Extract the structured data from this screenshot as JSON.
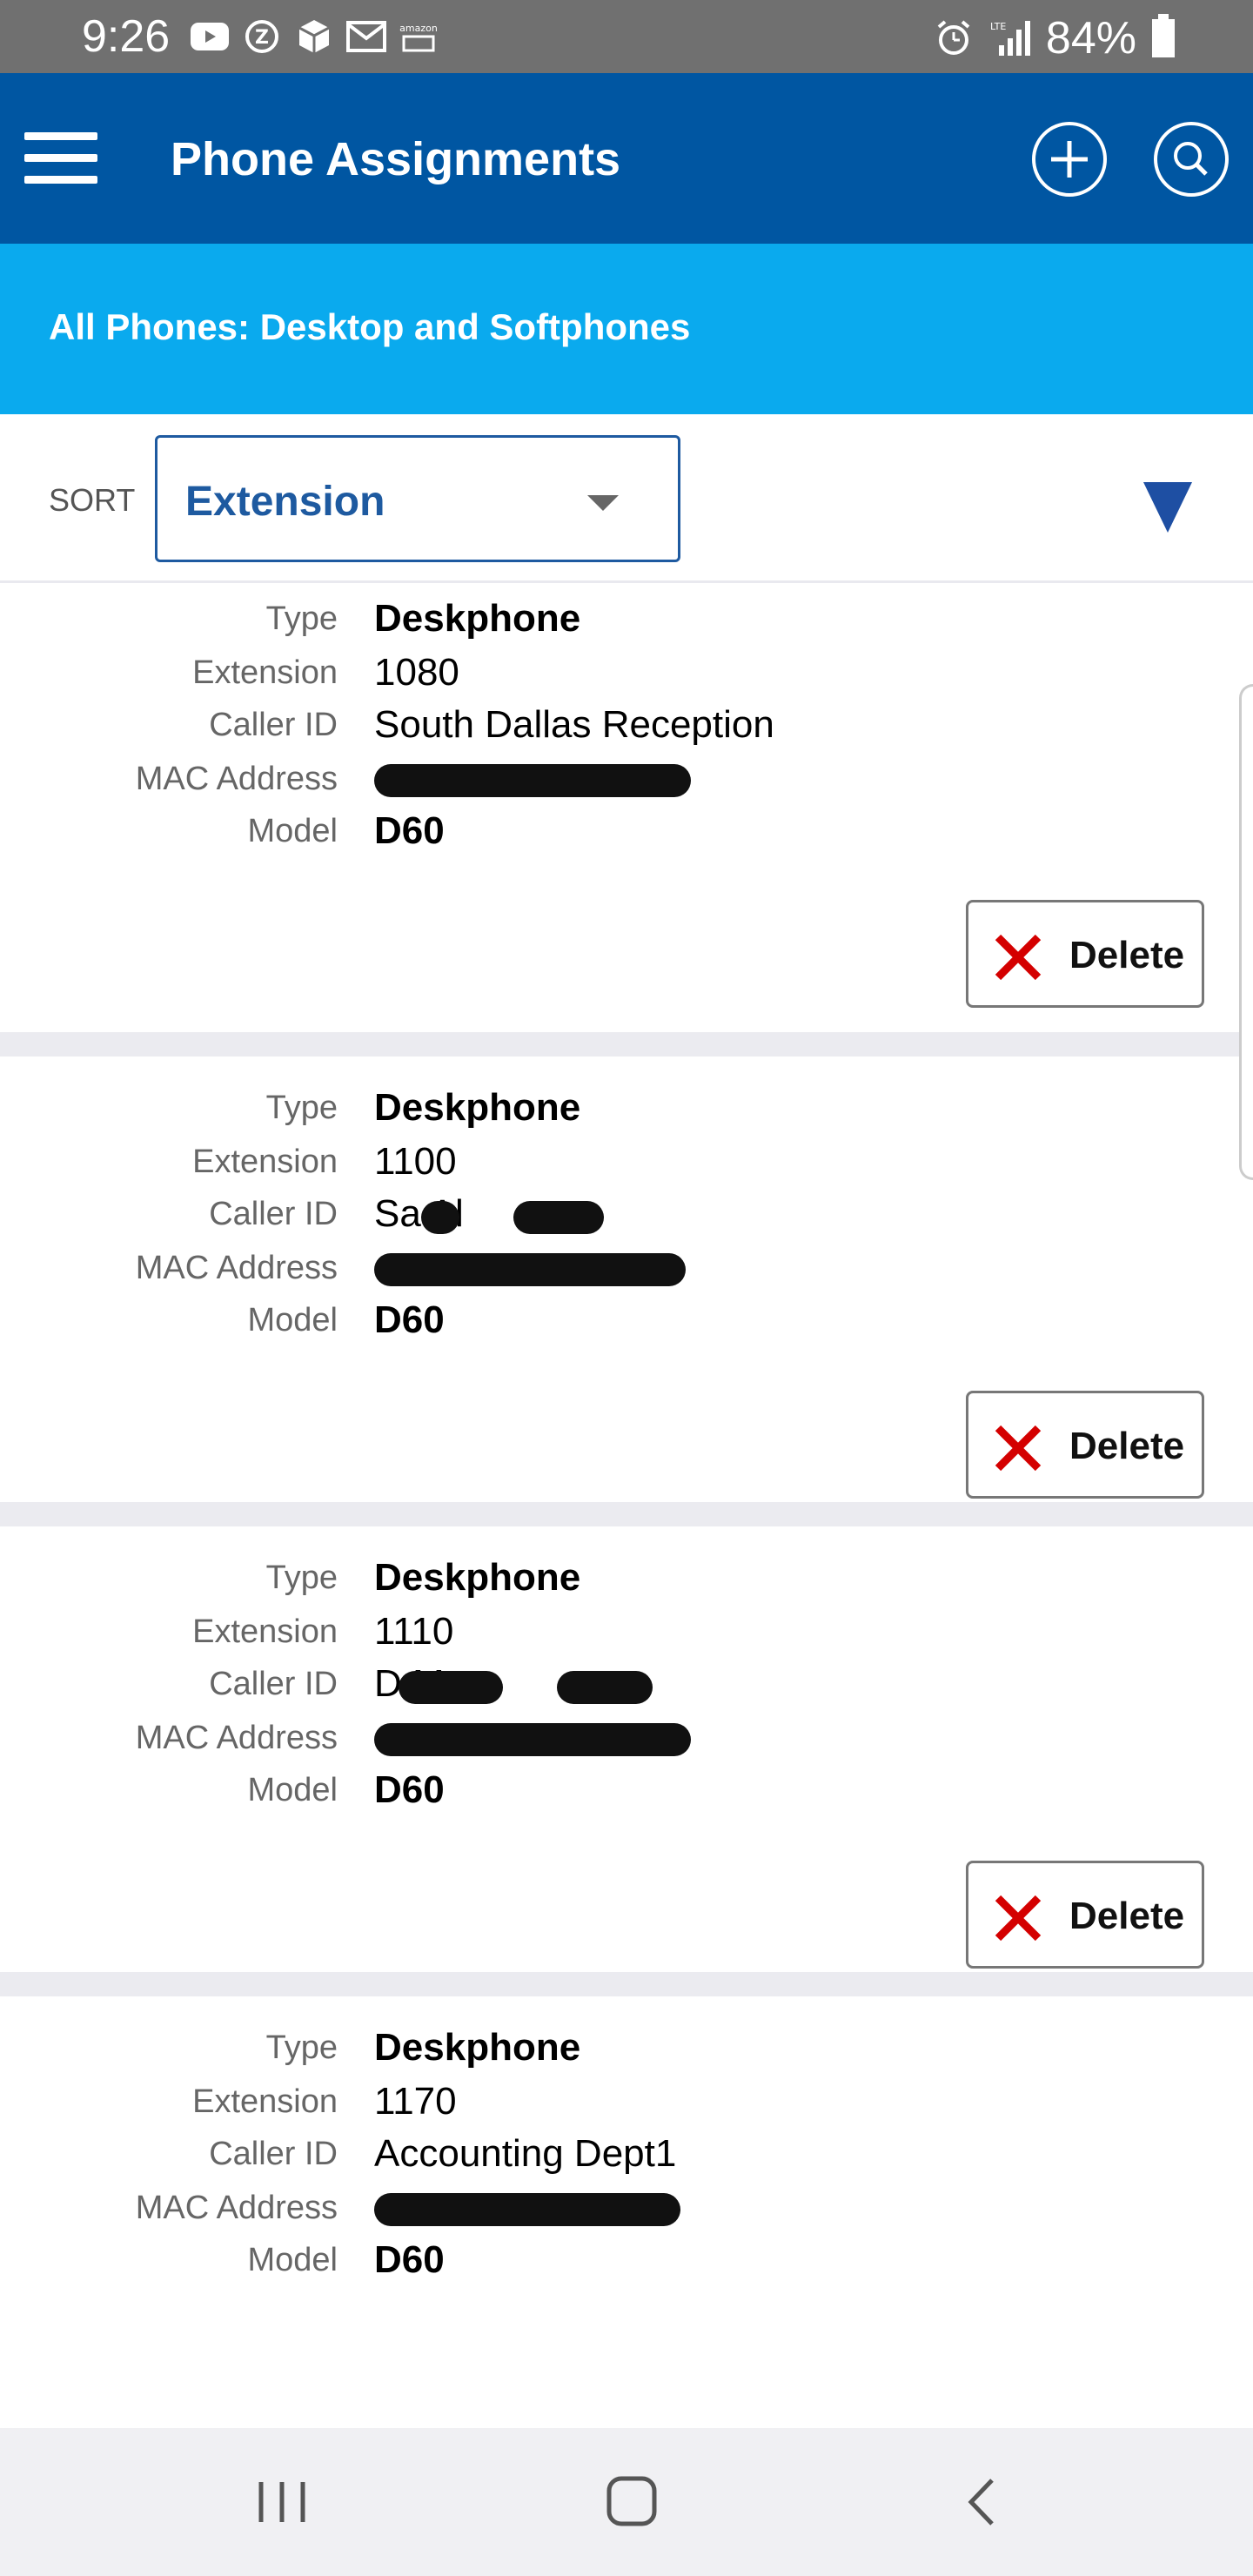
{
  "status_bar": {
    "time": "9:26",
    "battery": "84%"
  },
  "header": {
    "title": "Phone Assignments"
  },
  "sub_header": {
    "title": "All Phones: Desktop and Softphones"
  },
  "sort": {
    "label": "SORT",
    "value": "Extension"
  },
  "labels": {
    "type": "Type",
    "extension": "Extension",
    "caller_id": "Caller ID",
    "mac": "MAC Address",
    "model": "Model",
    "delete": "Delete"
  },
  "phones": [
    {
      "type": "Deskphone",
      "extension": "1080",
      "caller_id": "South Dallas Reception",
      "model": "D60"
    },
    {
      "type": "Deskphone",
      "extension": "1100",
      "caller_id": "Sa   Al",
      "model": "D60"
    },
    {
      "type": "Deskphone",
      "extension": "1110",
      "caller_id": "D        Ma",
      "model": "D60"
    },
    {
      "type": "Deskphone",
      "extension": "1170",
      "caller_id": "Accounting Dept1",
      "model": "D60"
    }
  ],
  "colors": {
    "header_bg": "#0056a2",
    "subheader_bg": "#0aaaee",
    "accent": "#1e5aa0",
    "delete_x": "#d40000"
  }
}
